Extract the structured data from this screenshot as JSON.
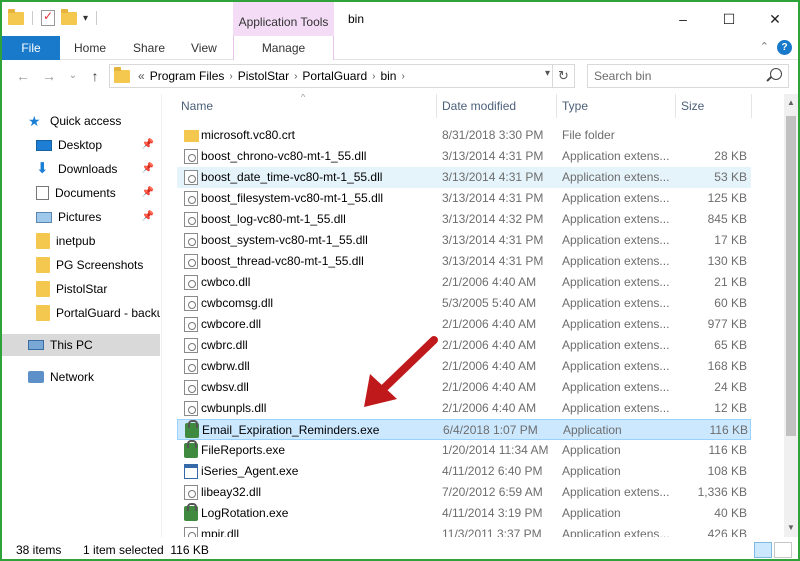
{
  "window": {
    "title": "bin",
    "context_tab_group": "Application Tools",
    "controls": {
      "minimize": "–",
      "maximize": "☐",
      "close": "✕"
    }
  },
  "ribbon": {
    "tabs": [
      "File",
      "Home",
      "Share",
      "View"
    ],
    "context_tab": "Manage",
    "collapse_glyph": "⌃",
    "help_glyph": "?"
  },
  "address": {
    "overflow": "«",
    "crumbs": [
      "Program Files",
      "PistolStar",
      "PortalGuard",
      "bin"
    ],
    "search_placeholder": "Search bin"
  },
  "nav": {
    "back": "←",
    "forward": "→",
    "recent": "⌄",
    "up": "↑",
    "pin_glyph": "📌",
    "items": [
      {
        "label": "Quick access",
        "icon": "star-icon"
      },
      {
        "label": "Desktop",
        "icon": "desktop-icon",
        "pinned": true
      },
      {
        "label": "Downloads",
        "icon": "download-icon",
        "pinned": true
      },
      {
        "label": "Documents",
        "icon": "documents-icon",
        "pinned": true
      },
      {
        "label": "Pictures",
        "icon": "pictures-icon",
        "pinned": true
      },
      {
        "label": "inetpub",
        "icon": "folder-icon"
      },
      {
        "label": "PG Screenshots",
        "icon": "folder-icon"
      },
      {
        "label": "PistolStar",
        "icon": "folder-icon"
      },
      {
        "label": "PortalGuard - backu",
        "icon": "folder-icon"
      },
      {
        "label": "This PC",
        "icon": "pc-icon",
        "selected": true
      },
      {
        "label": "Network",
        "icon": "network-icon"
      }
    ]
  },
  "columns": {
    "name": "Name",
    "date": "Date modified",
    "type": "Type",
    "size": "Size"
  },
  "files": [
    {
      "name": "microsoft.vc80.crt",
      "date": "8/31/2018 3:30 PM",
      "type": "File folder",
      "size": "",
      "icon": "folder"
    },
    {
      "name": "boost_chrono-vc80-mt-1_55.dll",
      "date": "3/13/2014 4:31 PM",
      "type": "Application extens...",
      "size": "28 KB",
      "icon": "dll"
    },
    {
      "name": "boost_date_time-vc80-mt-1_55.dll",
      "date": "3/13/2014 4:31 PM",
      "type": "Application extens...",
      "size": "53 KB",
      "icon": "dll",
      "hover": true
    },
    {
      "name": "boost_filesystem-vc80-mt-1_55.dll",
      "date": "3/13/2014 4:31 PM",
      "type": "Application extens...",
      "size": "125 KB",
      "icon": "dll"
    },
    {
      "name": "boost_log-vc80-mt-1_55.dll",
      "date": "3/13/2014 4:32 PM",
      "type": "Application extens...",
      "size": "845 KB",
      "icon": "dll"
    },
    {
      "name": "boost_system-vc80-mt-1_55.dll",
      "date": "3/13/2014 4:31 PM",
      "type": "Application extens...",
      "size": "17 KB",
      "icon": "dll"
    },
    {
      "name": "boost_thread-vc80-mt-1_55.dll",
      "date": "3/13/2014 4:31 PM",
      "type": "Application extens...",
      "size": "130 KB",
      "icon": "dll"
    },
    {
      "name": "cwbco.dll",
      "date": "2/1/2006 4:40 AM",
      "type": "Application extens...",
      "size": "21 KB",
      "icon": "dll"
    },
    {
      "name": "cwbcomsg.dll",
      "date": "5/3/2005 5:40 AM",
      "type": "Application extens...",
      "size": "60 KB",
      "icon": "dll"
    },
    {
      "name": "cwbcore.dll",
      "date": "2/1/2006 4:40 AM",
      "type": "Application extens...",
      "size": "977 KB",
      "icon": "dll"
    },
    {
      "name": "cwbrc.dll",
      "date": "2/1/2006 4:40 AM",
      "type": "Application extens...",
      "size": "65 KB",
      "icon": "dll"
    },
    {
      "name": "cwbrw.dll",
      "date": "2/1/2006 4:40 AM",
      "type": "Application extens...",
      "size": "168 KB",
      "icon": "dll"
    },
    {
      "name": "cwbsv.dll",
      "date": "2/1/2006 4:40 AM",
      "type": "Application extens...",
      "size": "24 KB",
      "icon": "dll"
    },
    {
      "name": "cwbunpls.dll",
      "date": "2/1/2006 4:40 AM",
      "type": "Application extens...",
      "size": "12 KB",
      "icon": "dll"
    },
    {
      "name": "Email_Expiration_Reminders.exe",
      "date": "6/4/2018 1:07 PM",
      "type": "Application",
      "size": "116 KB",
      "icon": "exe-lock",
      "selected": true
    },
    {
      "name": "FileReports.exe",
      "date": "1/20/2014 11:34 AM",
      "type": "Application",
      "size": "116 KB",
      "icon": "exe-lock"
    },
    {
      "name": "iSeries_Agent.exe",
      "date": "4/11/2012 6:40 PM",
      "type": "Application",
      "size": "108 KB",
      "icon": "exe-win"
    },
    {
      "name": "libeay32.dll",
      "date": "7/20/2012 6:59 AM",
      "type": "Application extens...",
      "size": "1,336 KB",
      "icon": "dll"
    },
    {
      "name": "LogRotation.exe",
      "date": "4/11/2014 3:19 PM",
      "type": "Application",
      "size": "40 KB",
      "icon": "exe-lock"
    },
    {
      "name": "mpir.dll",
      "date": "11/3/2011 3:37 PM",
      "type": "Application extens...",
      "size": "426 KB",
      "icon": "dll"
    }
  ],
  "status": {
    "count": "38 items",
    "selection": "1 item selected  116 KB"
  },
  "colors": {
    "accent": "#1979ca",
    "frame": "#2fa33a",
    "arrow": "#c0191b",
    "context_tab": "#f4dcf6",
    "selection": "#cce8ff"
  }
}
